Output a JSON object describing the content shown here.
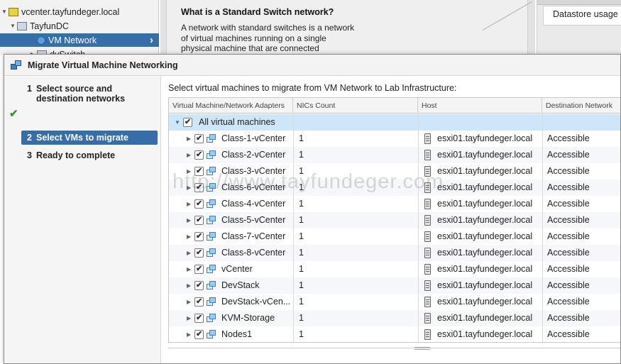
{
  "background": {
    "nav": {
      "items": [
        {
          "label": "vcenter.tayfundeger.local",
          "icon": "vcenter-icon"
        },
        {
          "label": "TayfunDC",
          "icon": "datacenter-icon"
        },
        {
          "label": "VM Network",
          "icon": "network-icon",
          "selected": true
        },
        {
          "label": "dvSwitch",
          "icon": "dvswitch-icon"
        }
      ]
    },
    "help": {
      "title": "What is a Standard Switch network?",
      "text": "A network with standard switches is a network of virtual machines running on a single physical machine that are connected"
    },
    "right_panel": {
      "label": "Datastore usage"
    }
  },
  "dialog": {
    "title": "Migrate Virtual Machine Networking",
    "steps": [
      {
        "num": "1",
        "label": "Select source and destination networks",
        "completed": true
      },
      {
        "num": "2",
        "label": "Select VMs to migrate",
        "active": true
      },
      {
        "num": "3",
        "label": "Ready to complete"
      }
    ],
    "instruction": "Select virtual machines to migrate from VM Network to Lab Infrastructure:",
    "grid": {
      "columns": [
        "Virtual Machine/Network Adapters",
        "NICs Count",
        "Host",
        "Destination Network"
      ],
      "all_row": {
        "label": "All virtual machines"
      },
      "rows": [
        {
          "name": "Class-1-vCenter",
          "nics": "1",
          "host": "esxi01.tayfundeger.local",
          "dest": "Accessible"
        },
        {
          "name": "Class-2-vCenter",
          "nics": "1",
          "host": "esxi01.tayfundeger.local",
          "dest": "Accessible"
        },
        {
          "name": "Class-3-vCenter",
          "nics": "1",
          "host": "esxi01.tayfundeger.local",
          "dest": "Accessible"
        },
        {
          "name": "Class-6-vCenter",
          "nics": "1",
          "host": "esxi01.tayfundeger.local",
          "dest": "Accessible"
        },
        {
          "name": "Class-4-vCenter",
          "nics": "1",
          "host": "esxi01.tayfundeger.local",
          "dest": "Accessible"
        },
        {
          "name": "Class-5-vCenter",
          "nics": "1",
          "host": "esxi01.tayfundeger.local",
          "dest": "Accessible"
        },
        {
          "name": "Class-7-vCenter",
          "nics": "1",
          "host": "esxi01.tayfundeger.local",
          "dest": "Accessible"
        },
        {
          "name": "Class-8-vCenter",
          "nics": "1",
          "host": "esxi01.tayfundeger.local",
          "dest": "Accessible"
        },
        {
          "name": "vCenter",
          "nics": "1",
          "host": "esxi01.tayfundeger.local",
          "dest": "Accessible"
        },
        {
          "name": "DevStack",
          "nics": "1",
          "host": "esxi01.tayfundeger.local",
          "dest": "Accessible"
        },
        {
          "name": "DevStack-vCen...",
          "nics": "1",
          "host": "esxi01.tayfundeger.local",
          "dest": "Accessible"
        },
        {
          "name": "KVM-Storage",
          "nics": "1",
          "host": "esxi01.tayfundeger.local",
          "dest": "Accessible"
        },
        {
          "name": "Nodes1",
          "nics": "1",
          "host": "esxi01.tayfundeger.local",
          "dest": "Accessible"
        }
      ]
    }
  },
  "watermark": "http://www.tayfundeger.com",
  "colors": {
    "selection": "#356ea8",
    "all_row": "#cde6f8",
    "check": "#2e9b2e"
  }
}
